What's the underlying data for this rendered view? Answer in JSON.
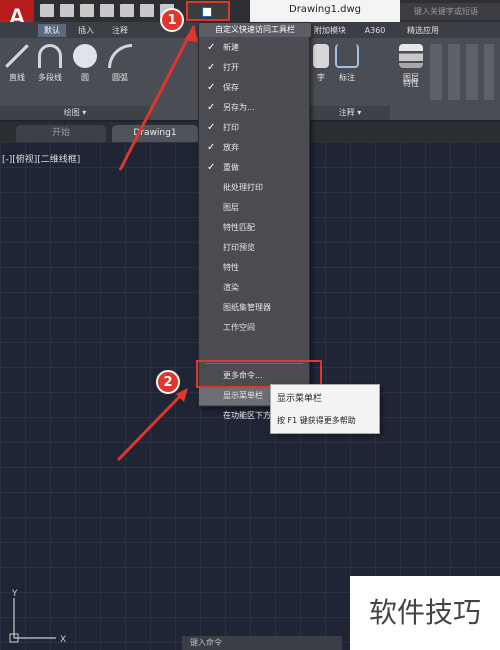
{
  "app": {
    "logo_letter": "A",
    "doc_title": "Drawing1.dwg",
    "search_placeholder": "键入关键字或短语"
  },
  "ribbon_tabs": [
    "默认",
    "插入",
    "注释",
    "附加模块",
    "A360",
    "精选应用"
  ],
  "ribbon_tools": [
    {
      "name": "line",
      "label": "直线"
    },
    {
      "name": "polyline",
      "label": "多段线"
    },
    {
      "name": "circle",
      "label": "圆"
    },
    {
      "name": "arc",
      "label": "圆弧"
    },
    {
      "name": "text",
      "label": "字"
    },
    {
      "name": "dimension",
      "label": "标注"
    },
    {
      "name": "layers",
      "label": "图层"
    },
    {
      "name": "properties",
      "label": "特性"
    }
  ],
  "ribbon_panels": {
    "draw": "绘图 ▾",
    "annotate": "注释 ▾"
  },
  "file_tabs": {
    "start": "开始",
    "drawing": "Drawing1"
  },
  "viewport_label": "[-][俯视][二维线框]",
  "menu": {
    "title": "自定义快速访问工具栏",
    "items": [
      {
        "label": "新建",
        "checked": true
      },
      {
        "label": "打开",
        "checked": true
      },
      {
        "label": "保存",
        "checked": true
      },
      {
        "label": "另存为...",
        "checked": true
      },
      {
        "label": "打印",
        "checked": true
      },
      {
        "label": "放弃",
        "checked": true
      },
      {
        "label": "重做",
        "checked": true
      },
      {
        "label": "批处理打印",
        "checked": false
      },
      {
        "label": "图层",
        "checked": false
      },
      {
        "label": "特性匹配",
        "checked": false
      },
      {
        "label": "打印预览",
        "checked": false
      },
      {
        "label": "特性",
        "checked": false
      },
      {
        "label": "渲染",
        "checked": false
      },
      {
        "label": "图纸集管理器",
        "checked": false
      },
      {
        "label": "工作空间",
        "checked": false
      },
      {
        "label": "更多命令...",
        "checked": false
      },
      {
        "label": "显示菜单栏",
        "checked": false
      },
      {
        "label": "在功能区下方显示",
        "checked": false
      }
    ],
    "check_glyph": "✓"
  },
  "tooltip": {
    "title": "显示菜单栏",
    "help": "按 F1 键获得更多帮助"
  },
  "annotations": {
    "badge1": "1",
    "badge2": "2",
    "color": "#e0362c"
  },
  "ucs": {
    "x": "X",
    "y": "Y"
  },
  "watermark": "软件技巧",
  "command_line": "键入命令"
}
